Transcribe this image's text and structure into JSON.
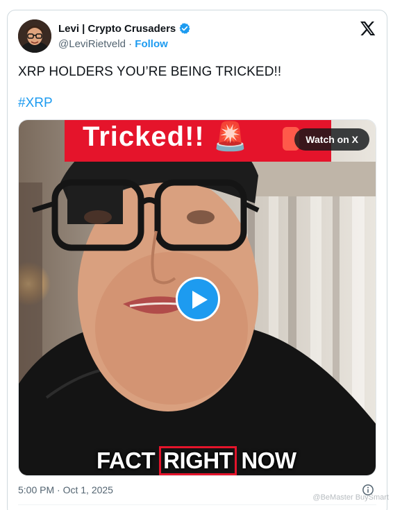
{
  "author": {
    "display_name": "Levi | Crypto Crusaders",
    "handle": "@LeviRietveld",
    "separator": " · ",
    "follow_label": "Follow"
  },
  "tweet": {
    "text": "XRP HOLDERS YOU’RE BEING TRICKED!!",
    "hashtag": "#XRP"
  },
  "media": {
    "banner_text": "Tricked!! 🚨",
    "watch_label": "Watch on X",
    "caption_before": "FACT",
    "caption_highlight": "RIGHT",
    "caption_after": "NOW"
  },
  "footer": {
    "timestamp": "5:00 PM · Oct 1, 2025",
    "watermark": "@BeMaster BuySmart"
  },
  "colors": {
    "accent": "#1d9bf0",
    "text": "#0f1419",
    "muted": "#536471",
    "banner_red": "#e5142b"
  },
  "icons": [
    "verified-badge-icon",
    "x-logo-icon",
    "play-icon",
    "info-icon"
  ]
}
